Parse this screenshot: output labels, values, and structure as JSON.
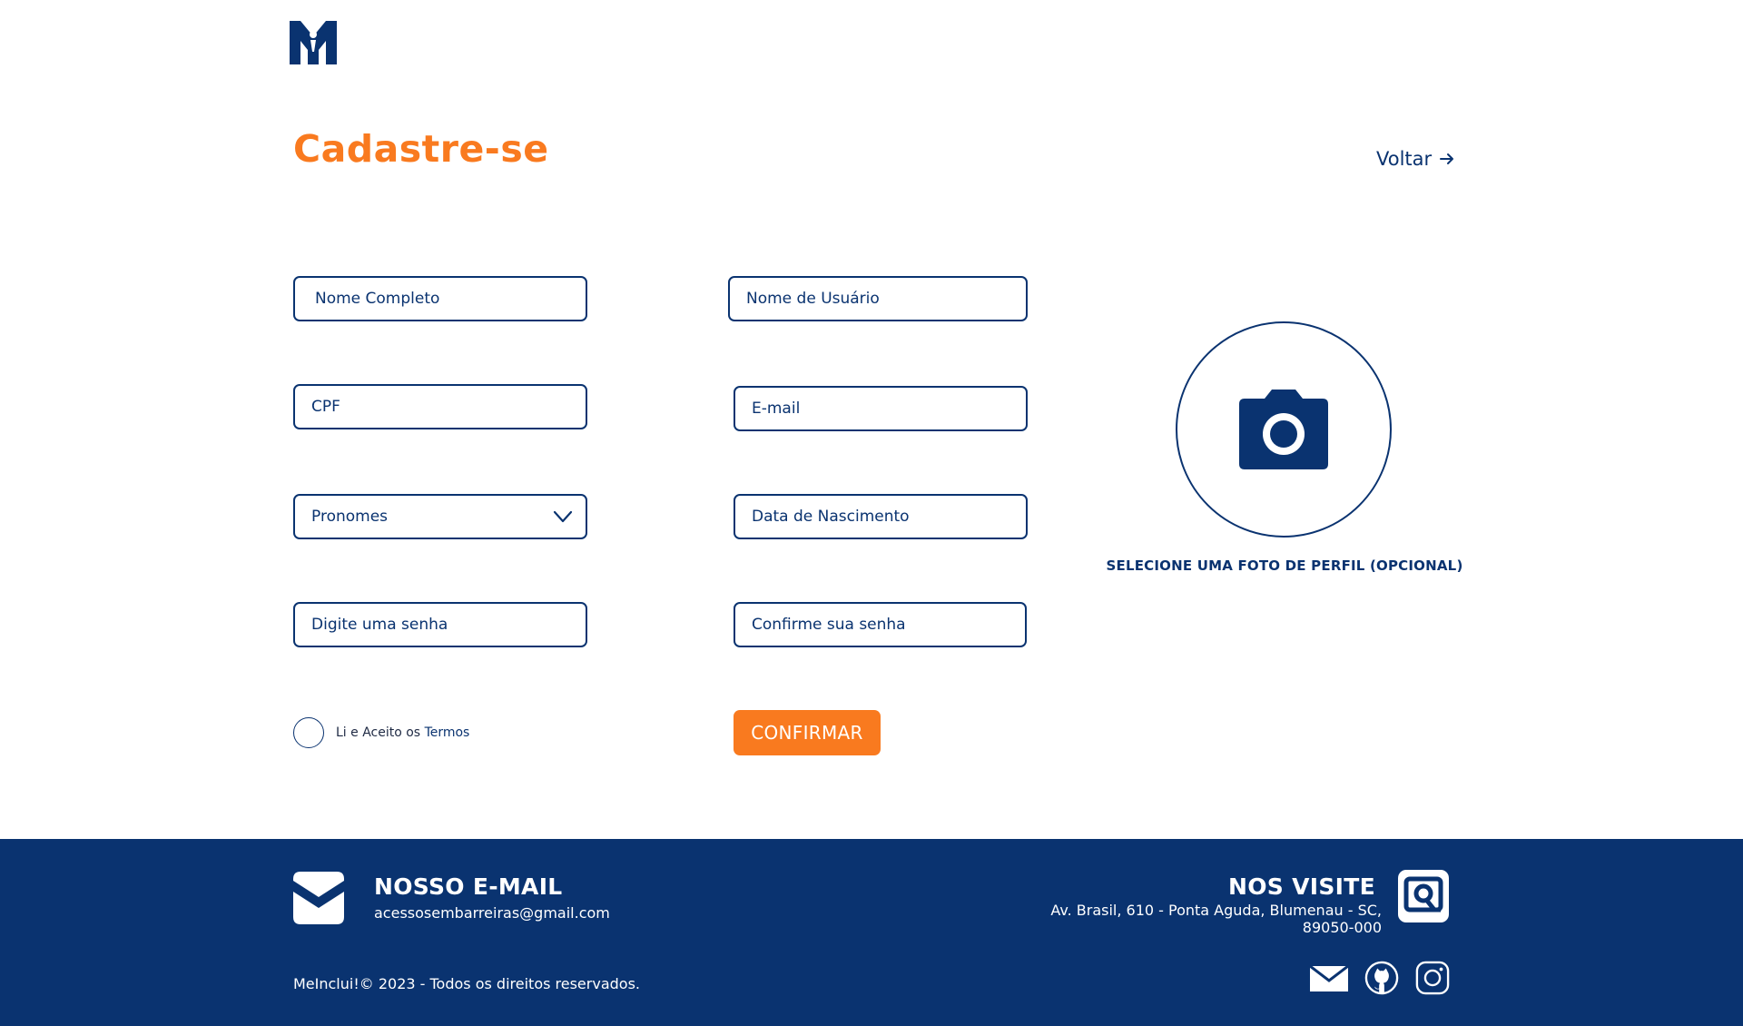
{
  "header": {
    "logo_icon": "meinclui-logo"
  },
  "page": {
    "title": "Cadastre-se",
    "back_label": "Voltar"
  },
  "form": {
    "nome_completo": {
      "placeholder": "Nome Completo",
      "value": ""
    },
    "nome_usuario": {
      "placeholder": "Nome de Usuário",
      "value": ""
    },
    "cpf": {
      "placeholder": "CPF",
      "value": ""
    },
    "email": {
      "placeholder": "E-mail",
      "value": ""
    },
    "pronomes": {
      "selected": "Pronomes"
    },
    "data_nascimento": {
      "placeholder": "Data de Nascimento",
      "value": ""
    },
    "senha": {
      "placeholder": "Digite uma senha",
      "value": ""
    },
    "confirma_senha": {
      "placeholder": "Confirme sua senha",
      "value": ""
    },
    "terms_text": "Li e Aceito os",
    "terms_link": "Termos",
    "confirm_label": "CONFIRMAR"
  },
  "photo": {
    "caption": "SELECIONE UMA FOTO DE PERFIL (OPCIONAL)",
    "icon": "camera-icon"
  },
  "footer": {
    "email_title": "NOSSO E-MAIL",
    "email_address": "acessosembarreiras@gmail.com",
    "visit_title": "NOS VISITE",
    "address": "Av. Brasil, 610 - Ponta Aguda, Blumenau - SC, 89050-000",
    "copyright": "MeInclui!© 2023 - Todos os direitos reservados.",
    "social_icons": [
      "mail-icon",
      "github-icon",
      "instagram-icon"
    ]
  },
  "colors": {
    "primary": "#0a3370",
    "accent": "#f97a1f",
    "background": "#ffffff"
  }
}
